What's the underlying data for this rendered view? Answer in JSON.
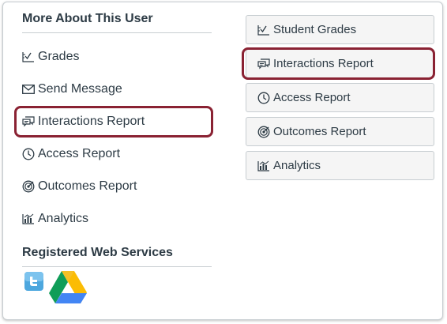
{
  "left": {
    "heading": "More About This User",
    "links": [
      {
        "label": "Grades",
        "icon": "gradebook-icon"
      },
      {
        "label": "Send Message",
        "icon": "envelope-icon"
      },
      {
        "label": "Interactions Report",
        "icon": "discussion-icon"
      },
      {
        "label": "Access Report",
        "icon": "clock-icon"
      },
      {
        "label": "Outcomes Report",
        "icon": "outcomes-icon"
      },
      {
        "label": "Analytics",
        "icon": "analytics-icon"
      }
    ],
    "services_heading": "Registered Web Services",
    "services": [
      {
        "name": "twitter",
        "icon": "twitter-icon"
      },
      {
        "name": "google-drive",
        "icon": "google-drive-icon"
      }
    ]
  },
  "right": {
    "buttons": [
      {
        "label": "Student Grades",
        "icon": "gradebook-icon"
      },
      {
        "label": "Interactions Report",
        "icon": "discussion-icon"
      },
      {
        "label": "Access Report",
        "icon": "clock-icon"
      },
      {
        "label": "Outcomes Report",
        "icon": "outcomes-icon"
      },
      {
        "label": "Analytics",
        "icon": "analytics-icon"
      }
    ]
  },
  "colors": {
    "highlight": "#8a2233",
    "text": "#2d3b45",
    "button_bg": "#f5f5f5",
    "border": "#c7cdd1"
  }
}
